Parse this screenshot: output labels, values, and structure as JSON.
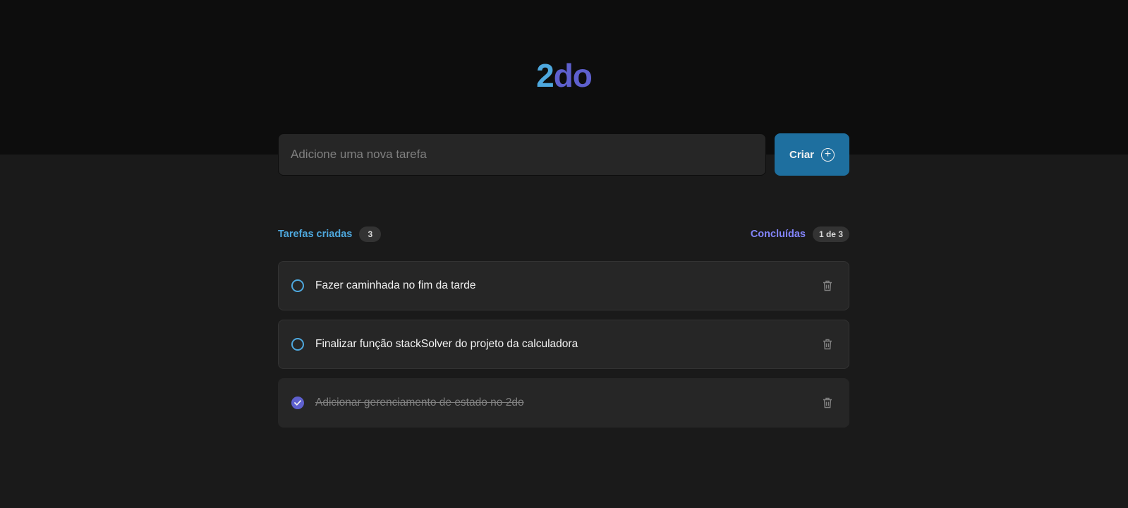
{
  "app": {
    "logo_part1": "2",
    "logo_part2": "do"
  },
  "new_task": {
    "placeholder": "Adicione uma nova tarefa",
    "value": "",
    "create_label": "Criar"
  },
  "counters": {
    "created_label": "Tarefas criadas",
    "created_count": "3",
    "done_label": "Concluídas",
    "done_count": "1 de 3"
  },
  "tasks": [
    {
      "text": "Fazer caminhada no fim da tarde",
      "completed": false
    },
    {
      "text": "Finalizar função stackSolver do projeto da calculadora",
      "completed": false
    },
    {
      "text": "Adicionar gerenciamento de estado no 2do",
      "completed": true
    }
  ],
  "icons": {
    "create": "plus-circle-icon",
    "unchecked": "circle-icon",
    "checked": "check-circle-icon",
    "delete": "trash-icon"
  },
  "colors": {
    "blue": "#4ea8de",
    "purple": "#5e60ce",
    "purple_light": "#8284fa",
    "button": "#1e6f9f",
    "background": "#1a1a1a",
    "header": "#0d0d0d",
    "card": "#262626"
  }
}
